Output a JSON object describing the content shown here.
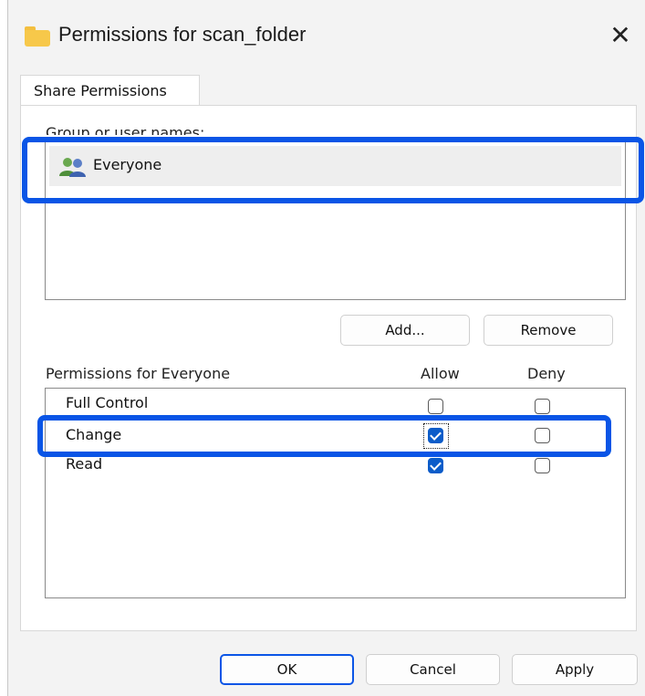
{
  "window": {
    "title": "Permissions for scan_folder",
    "close_glyph": "✕"
  },
  "tabs": [
    {
      "label": "Share Permissions",
      "selected": true
    }
  ],
  "group_section": {
    "label": "Group or user names:",
    "users": [
      {
        "name": "Everyone",
        "icon": "users-group-icon",
        "selected": true
      }
    ]
  },
  "buttons": {
    "add": "Add...",
    "remove": "Remove"
  },
  "permissions": {
    "header": "Permissions for Everyone",
    "allow_header": "Allow",
    "deny_header": "Deny",
    "rows": [
      {
        "name": "Full Control",
        "allow": false,
        "deny": false
      },
      {
        "name": "Change",
        "allow": true,
        "deny": false
      },
      {
        "name": "Read",
        "allow": true,
        "deny": false
      }
    ]
  },
  "footer": {
    "ok": "OK",
    "cancel": "Cancel",
    "apply": "Apply"
  },
  "colors": {
    "highlight": "#0a55e6",
    "checkbox_checked": "#0b5cc9",
    "folder": "#f7c84a"
  }
}
